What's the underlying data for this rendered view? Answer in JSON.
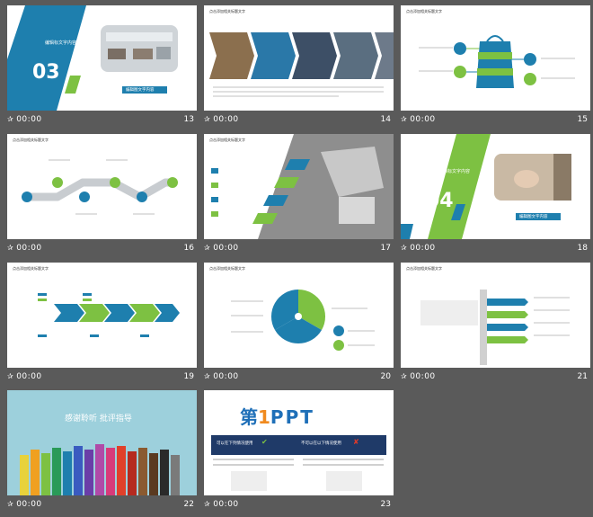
{
  "colors": {
    "blue": "#1e7fae",
    "green": "#7dc142",
    "background": "#5a5a5a"
  },
  "slides": [
    {
      "number": "13",
      "time": "00:00",
      "big_number": "03",
      "heading": "编辑标文字内容",
      "button": "编辑图文字内容"
    },
    {
      "number": "14",
      "time": "00:00",
      "heading": "点击添加相关标题文字"
    },
    {
      "number": "15",
      "time": "00:00",
      "heading": "点击添加相关标题文字"
    },
    {
      "number": "16",
      "time": "00:00",
      "heading": "点击添加相关标题文字"
    },
    {
      "number": "17",
      "time": "00:00",
      "heading": "点击添加相关标题文字"
    },
    {
      "number": "18",
      "time": "00:00",
      "big_number": "04",
      "heading": "编辑标文字内容",
      "button": "编辑图文字内容"
    },
    {
      "number": "19",
      "time": "00:00",
      "heading": "点击添加相关标题文字"
    },
    {
      "number": "20",
      "time": "00:00",
      "heading": "点击添加相关标题文字"
    },
    {
      "number": "21",
      "time": "00:00",
      "heading": "点击添加相关标题文字"
    },
    {
      "number": "22",
      "time": "00:00",
      "title": "感谢聆听 批评指导"
    },
    {
      "number": "23",
      "time": "00:00",
      "logo_char": "第",
      "logo_one": "1",
      "logo_ppt": "PPT",
      "banner_left": "可以在下列情况使用",
      "banner_right": "不可以在以下情况使用"
    }
  ]
}
